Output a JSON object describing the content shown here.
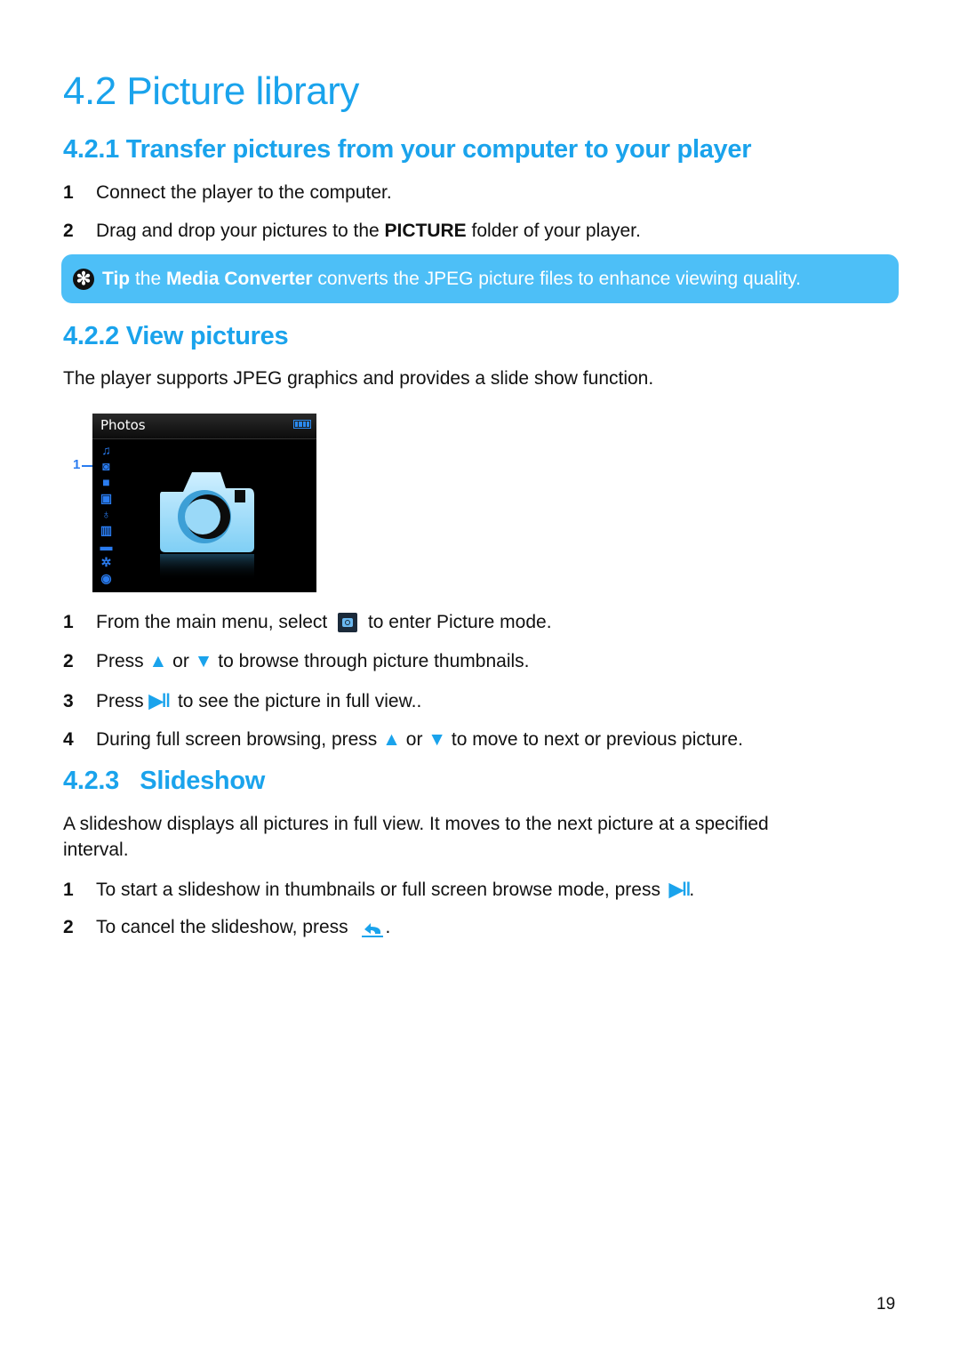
{
  "heading": "4.2 Picture library",
  "sections": [
    {
      "title": "4.2.1 Transfer pictures from your computer to your player",
      "steps": [
        {
          "num": "1",
          "text": "Connect the player to the computer."
        },
        {
          "num": "2",
          "pre": "Drag and drop your pictures to the ",
          "bold": "PICTURE",
          "post": " folder of your player."
        }
      ],
      "tip": {
        "icon": "tip-star-icon",
        "label": "Tip",
        "pre": " the ",
        "bold": "Media Converter",
        "post": " converts the JPEG picture files to enhance viewing quality."
      }
    },
    {
      "title": "4.2.2 View pictures",
      "intro": "The player supports JPEG graphics and provides a slide show function.",
      "device_screen": {
        "title": "Photos",
        "callout": "1",
        "menu_icons": [
          "music-icon",
          "camera-icon",
          "video-icon",
          "radio-icon",
          "microphone-icon",
          "audiobook-icon",
          "folder-icon",
          "settings-icon",
          "now-playing-icon"
        ]
      },
      "steps": [
        {
          "num": "1",
          "pre": "From the main menu, select ",
          "icon": "camera-icon",
          "post": " to enter Picture mode."
        },
        {
          "num": "2",
          "pre": "Press ",
          "up": "▲",
          "mid": " or ",
          "down": "▼",
          "post": " to browse through picture thumbnails."
        },
        {
          "num": "3",
          "pre": "Press ",
          "icon": "play-pause-icon",
          "post": " to see the picture in full view.."
        },
        {
          "num": "4",
          "pre": "During full screen browsing, press ",
          "up": "▲",
          "mid": " or ",
          "down": "▼",
          "post": " to move to next or previous picture."
        }
      ]
    },
    {
      "title": "4.2.3   Slideshow",
      "intro_line1": "A slideshow displays all pictures in full view. It moves to the next picture at a specified",
      "intro_line2": "interval.",
      "steps": [
        {
          "num": "1",
          "pre": "To start a slideshow in thumbnails or full screen browse mode, press ",
          "icon": "play-pause-icon",
          "post": "."
        },
        {
          "num": "2",
          "pre": "To cancel the slideshow, press ",
          "icon": "back-icon",
          "post": "."
        }
      ]
    }
  ],
  "page_number": "19",
  "colors": {
    "accent": "#1aa3ec",
    "tip_bg": "#4dbff7",
    "screen_icon": "#2a7cf0"
  }
}
